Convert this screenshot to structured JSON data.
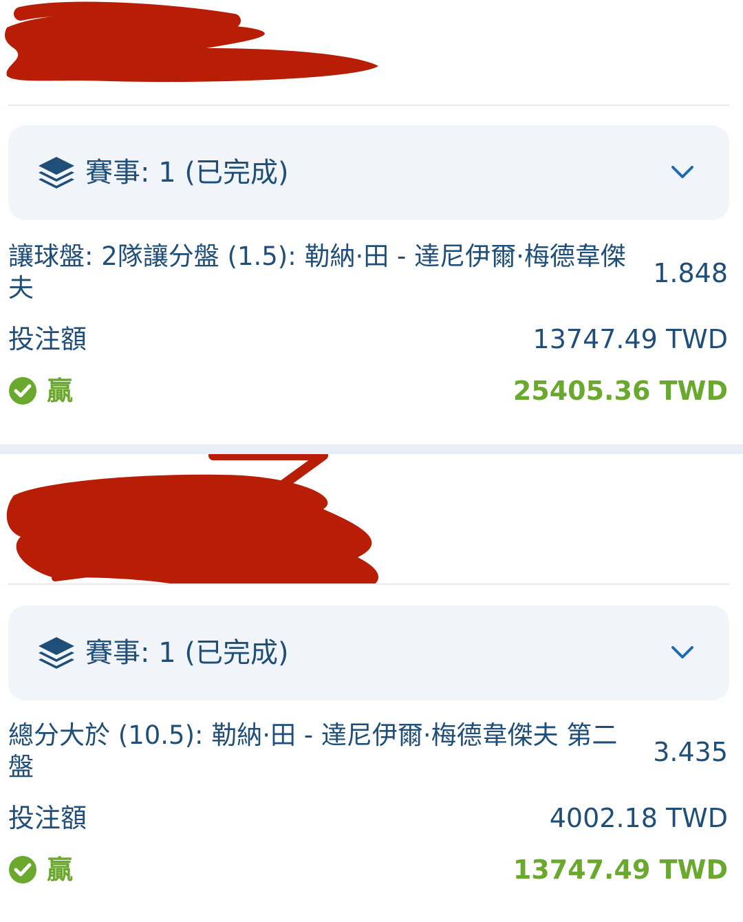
{
  "tickets": [
    {
      "event_label": "賽事: 1 (已完成)",
      "selection": "讓球盤: 2隊讓分盤 (1.5): 勒納·田 - 達尼伊爾·梅德韋傑夫",
      "odds": "1.848",
      "stake_label": "投注額",
      "stake_value": "13747.49 TWD",
      "result_label": "贏",
      "payout": "25405.36 TWD"
    },
    {
      "event_label": "賽事: 1 (已完成)",
      "selection": "總分大於 (10.5): 勒納·田 - 達尼伊爾·梅德韋傑夫 第二盤",
      "odds": "3.435",
      "stake_label": "投注額",
      "stake_value": "4002.18 TWD",
      "result_label": "贏",
      "payout": "13747.49 TWD"
    }
  ],
  "colors": {
    "text": "#1f4e79",
    "win": "#6aa82e",
    "panel": "#f1f5fa",
    "redaction": "#b81d06"
  }
}
